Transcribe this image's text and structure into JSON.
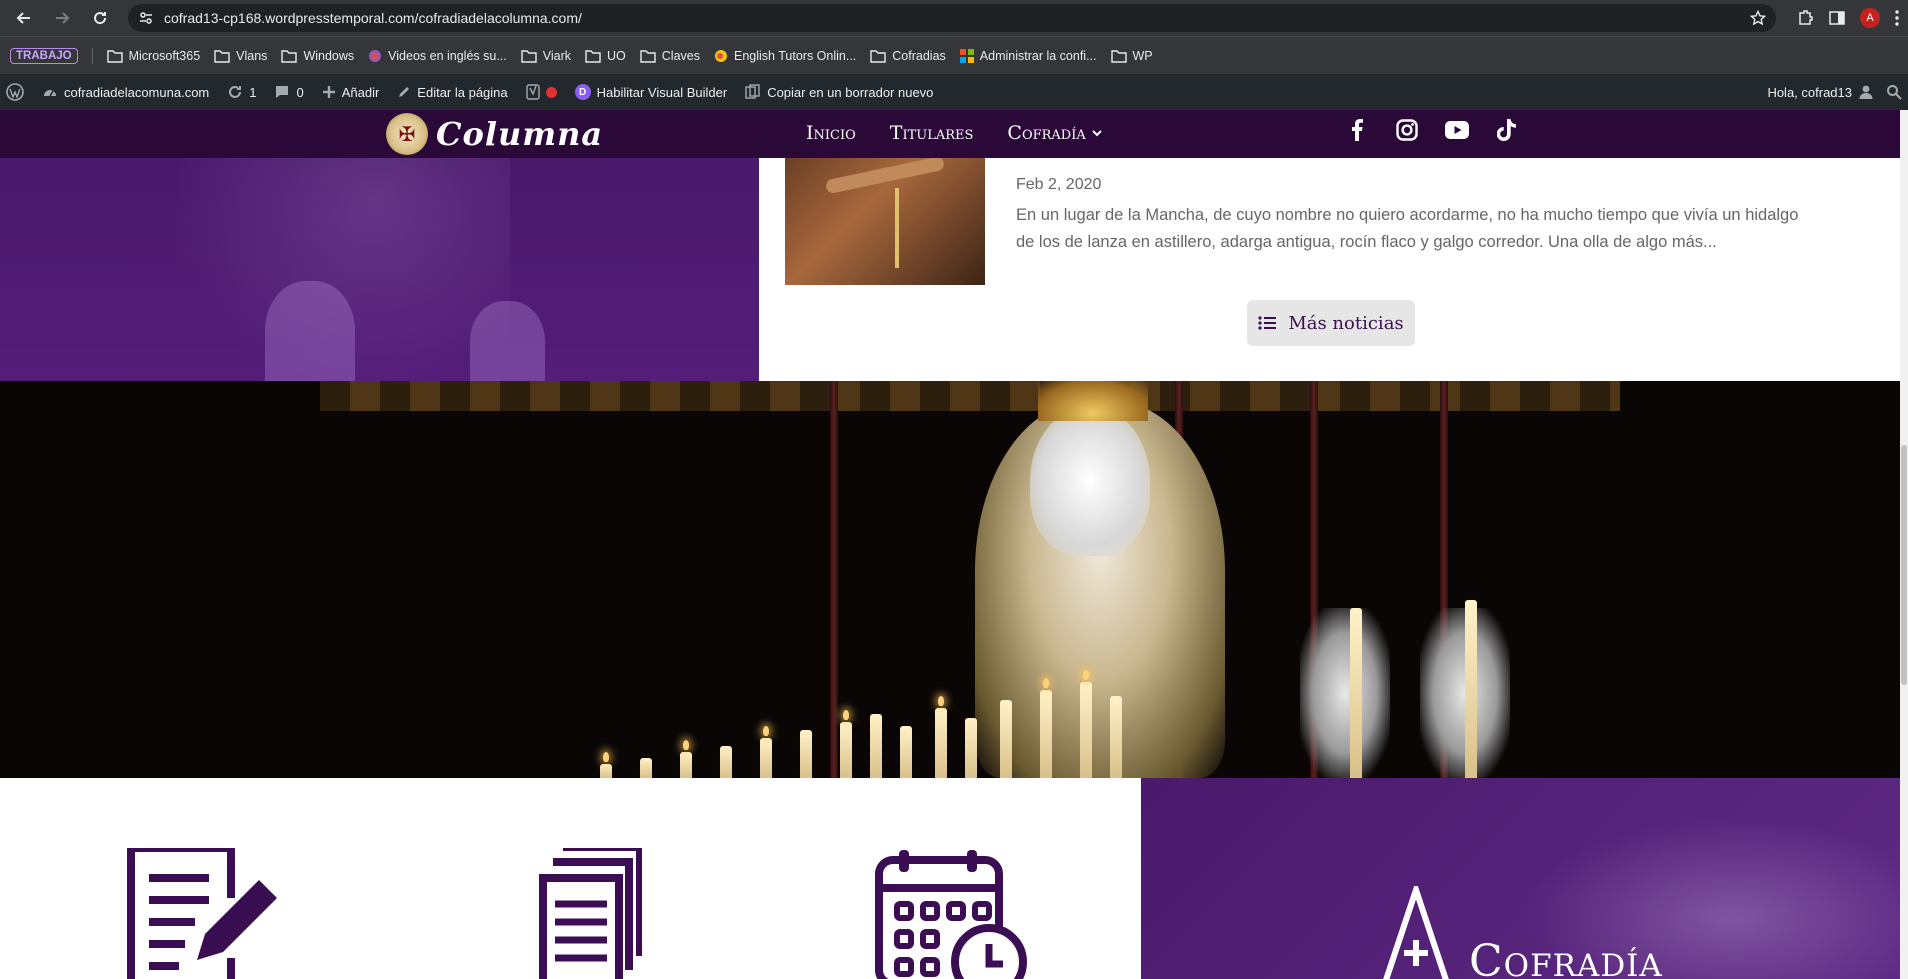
{
  "browser": {
    "url": "cofrad13-cp168.wordpresstemporal.com/cofradiadelacolumna.com/"
  },
  "bookmarks": {
    "group_label": "TRABAJO",
    "items": [
      {
        "label": "Microsoft365",
        "icon": "folder-icon"
      },
      {
        "label": "Vlans",
        "icon": "folder-icon"
      },
      {
        "label": "Windows",
        "icon": "folder-icon"
      },
      {
        "label": "Videos en inglés su...",
        "icon": "site-icon"
      },
      {
        "label": "Viark",
        "icon": "folder-icon"
      },
      {
        "label": "UO",
        "icon": "folder-icon"
      },
      {
        "label": "Claves",
        "icon": "folder-icon"
      },
      {
        "label": "English Tutors Onlin...",
        "icon": "site-icon"
      },
      {
        "label": "Cofradias",
        "icon": "folder-icon"
      },
      {
        "label": "Administrar la confi...",
        "icon": "microsoft-icon"
      },
      {
        "label": "WP",
        "icon": "folder-icon"
      }
    ]
  },
  "wp_admin": {
    "site_name": "cofradiadelacomuna.com",
    "updates_count": "1",
    "comments_count": "0",
    "add_label": "Añadir",
    "edit_label": "Editar la página",
    "visual_builder_label": "Habilitar Visual Builder",
    "copy_label": "Copiar en un borrador nuevo",
    "greeting": "Hola, cofrad13"
  },
  "site": {
    "logo_text": "Columna",
    "menu": [
      {
        "label": "Inicio"
      },
      {
        "label": "Titulares"
      },
      {
        "label": "Cofradía"
      }
    ],
    "social": [
      "facebook-icon",
      "instagram-icon",
      "youtube-icon",
      "tiktok-icon"
    ]
  },
  "news": {
    "date": "Feb 2, 2020",
    "excerpt": "En un lugar de la Mancha, de cuyo nombre no quiero acordarme, no ha mucho tiempo que vivía un hidalgo de los de lanza en astillero, adarga antigua, rocín flaco y galgo corredor. Una olla de algo más...",
    "more_button": "Más noticias"
  },
  "features": {
    "icons": [
      "form-edit-icon",
      "documents-icon",
      "calendar-clock-icon"
    ]
  },
  "cofradia_block": {
    "title": "Cofradía"
  },
  "colors": {
    "brand_purple": "#2a0838",
    "accent_purple": "#541d79",
    "icon_purple": "#3b0e54"
  }
}
